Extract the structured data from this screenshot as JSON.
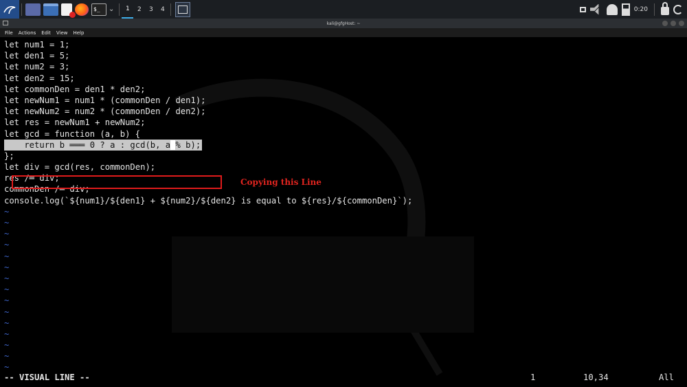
{
  "taskbar": {
    "workspaces": [
      "1",
      "2",
      "3",
      "4"
    ],
    "active_workspace": "1",
    "clock": "0:20",
    "icons": [
      "kali-menu-icon",
      "desktop-icon",
      "file-manager-icon",
      "text-editor-icon",
      "firefox-icon",
      "terminal-icon",
      "window-icon",
      "mute-icon",
      "notification-icon",
      "battery-icon",
      "lock-icon",
      "logout-icon"
    ]
  },
  "window": {
    "title": "kali@gfgHost: ~",
    "menu": [
      "File",
      "Actions",
      "Edit",
      "View",
      "Help"
    ]
  },
  "editor": {
    "lines": [
      "let num1 = 1;",
      "let den1 = 5;",
      "let num2 = 3;",
      "let den2 = 15;",
      "let commonDen = den1 * den2;",
      "let newNum1 = num1 * (commonDen / den1);",
      "let newNum2 = num2 * (commonDen / den2);",
      "let res = newNum1 + newNum2;",
      "let gcd = function (a, b) {"
    ],
    "selected_line_before_cursor": "    return b ═══ 0 ? a : gcd(b, a",
    "selected_line_cursor_char": " ",
    "selected_line_after_cursor": "% b);",
    "lines_after": [
      "};",
      "let div = gcd(res, commonDen);",
      "res /═ div;",
      "commonDen /═ div;",
      "console.log(`${num1}/${den1} + ${num2}/${den2} is equal to ${res}/${commonDen}`);"
    ],
    "tilde": "~",
    "tilde_count": 15,
    "annotation": "Copying this Line"
  },
  "status": {
    "mode": "-- VISUAL LINE --",
    "count": "1",
    "position": "10,34",
    "scroll": "All"
  },
  "colors": {
    "background": "#000000",
    "text": "#e6e6e6",
    "tilde": "#3d64c8",
    "selection": "#c8c8c8",
    "annotation": "#e0241f"
  }
}
